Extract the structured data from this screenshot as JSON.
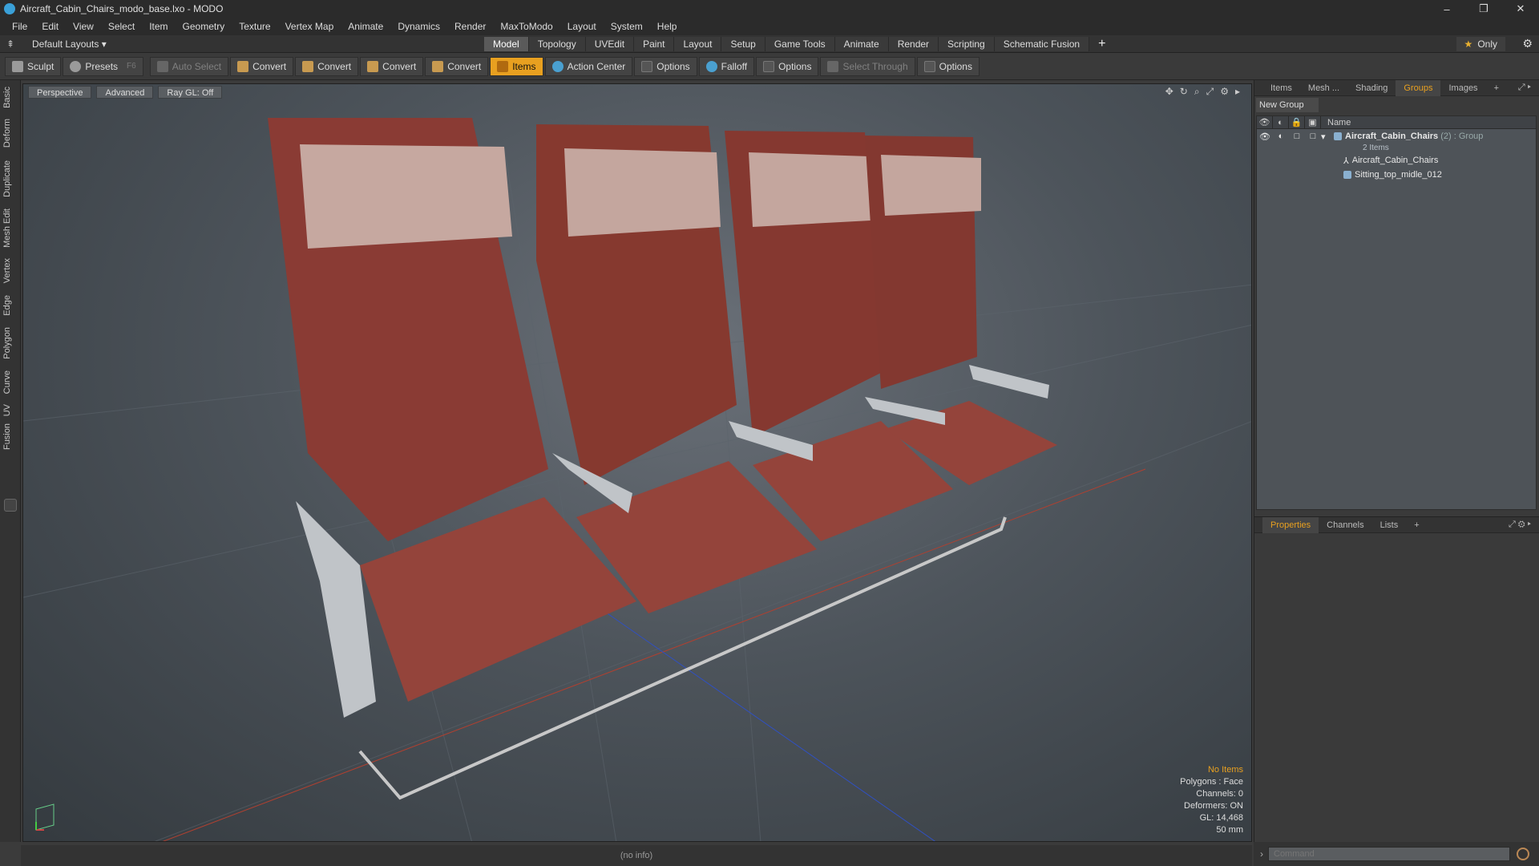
{
  "window": {
    "title": "Aircraft_Cabin_Chairs_modo_base.lxo - MODO",
    "minimize": "–",
    "maximize": "❐",
    "close": "✕"
  },
  "menu": [
    "File",
    "Edit",
    "View",
    "Select",
    "Item",
    "Geometry",
    "Texture",
    "Vertex Map",
    "Animate",
    "Dynamics",
    "Render",
    "MaxToModo",
    "Layout",
    "System",
    "Help"
  ],
  "layout": {
    "default_layouts": "Default Layouts ▾",
    "tabs": [
      "Model",
      "Topology",
      "UVEdit",
      "Paint",
      "Layout",
      "Setup",
      "Game Tools",
      "Animate",
      "Render",
      "Scripting",
      "Schematic Fusion"
    ],
    "active_tab": "Model",
    "plus": "+",
    "only": "Only"
  },
  "toolbar": {
    "sculpt": "Sculpt",
    "presets": "Presets",
    "presets_hint": "F6",
    "auto_select": "Auto Select",
    "convert1": "Convert",
    "convert2": "Convert",
    "convert3": "Convert",
    "convert4": "Convert",
    "items": "Items",
    "action_center": "Action Center",
    "options1": "Options",
    "falloff": "Falloff",
    "options2": "Options",
    "select_through": "Select Through",
    "options3": "Options"
  },
  "left_tabs": [
    "Basic",
    "Deform",
    "Duplicate",
    "Mesh Edit",
    "Vertex",
    "Edge",
    "Polygon",
    "Curve",
    "UV",
    "Fusion"
  ],
  "viewport": {
    "perspective": "Perspective",
    "advanced": "Advanced",
    "raygl": "Ray GL: Off",
    "info": {
      "no_items": "No Items",
      "polygons": "Polygons : Face",
      "channels": "Channels: 0",
      "deformers": "Deformers: ON",
      "gl": "GL: 14,468",
      "lens": "50 mm"
    }
  },
  "right_panel": {
    "tabs": [
      "Items",
      "Mesh ...",
      "Shading",
      "Groups",
      "Images"
    ],
    "active_tab": "Groups",
    "plus": "+",
    "new_group": "New Group",
    "name_header": "Name",
    "group": {
      "name": "Aircraft_Cabin_Chairs",
      "count": "(2)",
      "type": ": Group",
      "subtitle": "2 Items"
    },
    "children": [
      "Aircraft_Cabin_Chairs",
      "Sitting_top_midle_012"
    ]
  },
  "props_panel": {
    "tabs": [
      "Properties",
      "Channels",
      "Lists"
    ],
    "active_tab": "Properties",
    "plus": "+"
  },
  "command": {
    "placeholder": "Command"
  },
  "status": "(no info)"
}
